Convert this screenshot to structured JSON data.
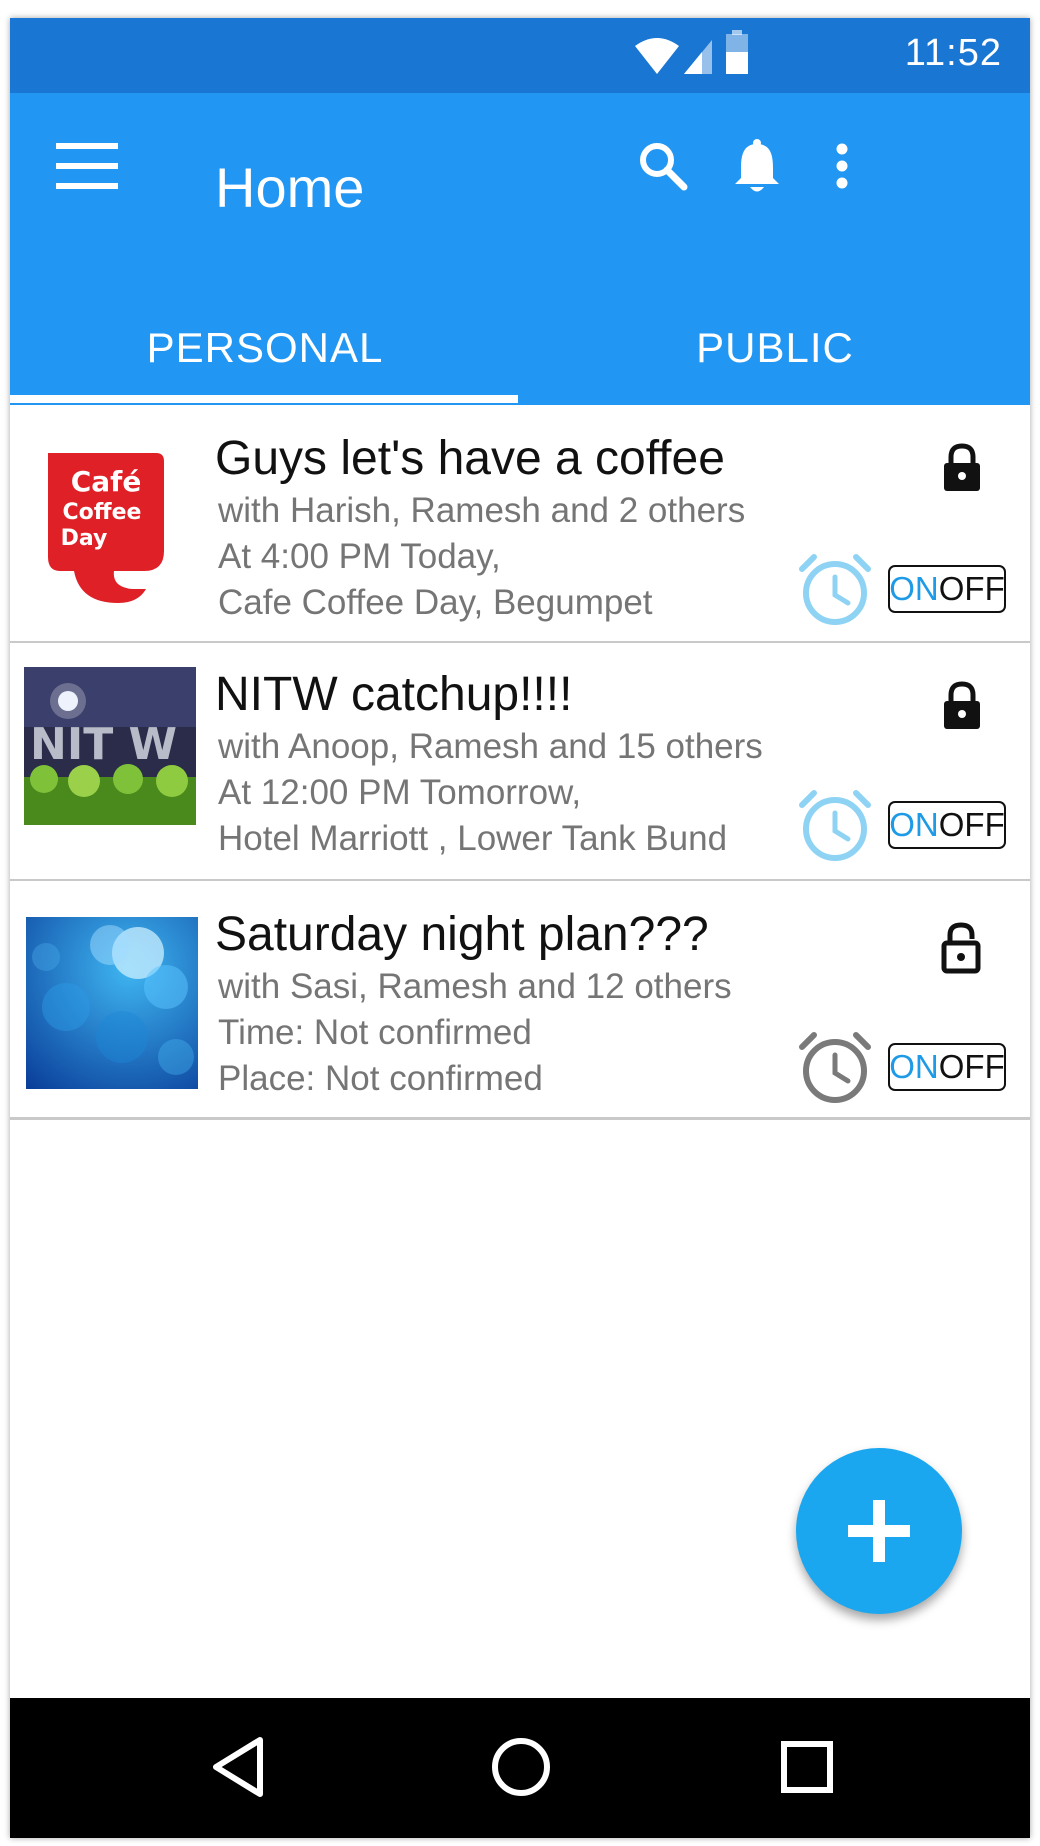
{
  "status_bar": {
    "time": "11:52",
    "icons": [
      "wifi-icon",
      "signal-icon",
      "battery-icon"
    ]
  },
  "app_bar": {
    "title": "Home",
    "icons": [
      "menu-icon",
      "search-icon",
      "bell-icon",
      "more-vert-icon"
    ]
  },
  "tabs": [
    {
      "label": "PERSONAL",
      "selected": true
    },
    {
      "label": "PUBLIC",
      "selected": false
    }
  ],
  "plans": [
    {
      "title": "Guys let's have a coffee",
      "with": "with Harish, Ramesh and 2 others",
      "time": "At 4:00 PM Today,",
      "place": "Cafe Coffee Day, Begumpet",
      "thumb_text": [
        "Café",
        "Coffee",
        "Day"
      ],
      "lock_state": "locked",
      "alarm_color": "#8fd3f4",
      "toggle_on": "ON",
      "toggle_off": "OFF"
    },
    {
      "title": "NITW catchup!!!!",
      "with": "with Anoop, Ramesh and 15 others",
      "time": "At 12:00 PM Tomorrow,",
      "place": "Hotel Marriott , Lower Tank Bund",
      "thumb_text": [
        "NIT W"
      ],
      "lock_state": "locked",
      "alarm_color": "#8fd3f4",
      "toggle_on": "ON",
      "toggle_off": "OFF"
    },
    {
      "title": "Saturday night plan???",
      "with": "with Sasi, Ramesh and 12 others",
      "time": "Time: Not confirmed",
      "place": "Place: Not confirmed",
      "lock_state": "unlocked",
      "alarm_color": "#7a7a7a",
      "toggle_on": "ON",
      "toggle_off": "OFF"
    }
  ],
  "fab": {
    "icon": "plus-icon"
  },
  "nav_bar": {
    "icons": [
      "back-icon",
      "home-icon",
      "recents-icon"
    ]
  },
  "colors": {
    "status_bar": "#1976d2",
    "app_bar": "#2196f3",
    "fab": "#1aa7f0",
    "toggle_on": "#1e9ae6"
  }
}
